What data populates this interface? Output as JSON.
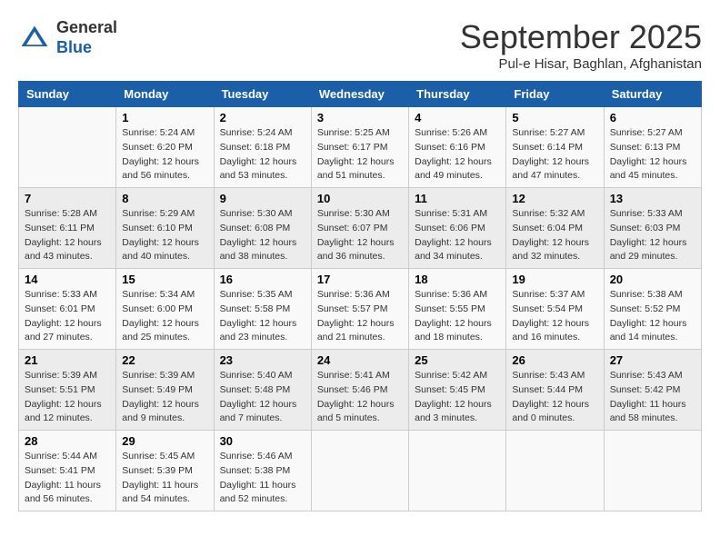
{
  "header": {
    "logo_general": "General",
    "logo_blue": "Blue",
    "month_title": "September 2025",
    "location": "Pul-e Hisar, Baghlan, Afghanistan"
  },
  "calendar": {
    "days_of_week": [
      "Sunday",
      "Monday",
      "Tuesday",
      "Wednesday",
      "Thursday",
      "Friday",
      "Saturday"
    ],
    "weeks": [
      [
        {
          "day": "",
          "info": ""
        },
        {
          "day": "1",
          "info": "Sunrise: 5:24 AM\nSunset: 6:20 PM\nDaylight: 12 hours\nand 56 minutes."
        },
        {
          "day": "2",
          "info": "Sunrise: 5:24 AM\nSunset: 6:18 PM\nDaylight: 12 hours\nand 53 minutes."
        },
        {
          "day": "3",
          "info": "Sunrise: 5:25 AM\nSunset: 6:17 PM\nDaylight: 12 hours\nand 51 minutes."
        },
        {
          "day": "4",
          "info": "Sunrise: 5:26 AM\nSunset: 6:16 PM\nDaylight: 12 hours\nand 49 minutes."
        },
        {
          "day": "5",
          "info": "Sunrise: 5:27 AM\nSunset: 6:14 PM\nDaylight: 12 hours\nand 47 minutes."
        },
        {
          "day": "6",
          "info": "Sunrise: 5:27 AM\nSunset: 6:13 PM\nDaylight: 12 hours\nand 45 minutes."
        }
      ],
      [
        {
          "day": "7",
          "info": "Sunrise: 5:28 AM\nSunset: 6:11 PM\nDaylight: 12 hours\nand 43 minutes."
        },
        {
          "day": "8",
          "info": "Sunrise: 5:29 AM\nSunset: 6:10 PM\nDaylight: 12 hours\nand 40 minutes."
        },
        {
          "day": "9",
          "info": "Sunrise: 5:30 AM\nSunset: 6:08 PM\nDaylight: 12 hours\nand 38 minutes."
        },
        {
          "day": "10",
          "info": "Sunrise: 5:30 AM\nSunset: 6:07 PM\nDaylight: 12 hours\nand 36 minutes."
        },
        {
          "day": "11",
          "info": "Sunrise: 5:31 AM\nSunset: 6:06 PM\nDaylight: 12 hours\nand 34 minutes."
        },
        {
          "day": "12",
          "info": "Sunrise: 5:32 AM\nSunset: 6:04 PM\nDaylight: 12 hours\nand 32 minutes."
        },
        {
          "day": "13",
          "info": "Sunrise: 5:33 AM\nSunset: 6:03 PM\nDaylight: 12 hours\nand 29 minutes."
        }
      ],
      [
        {
          "day": "14",
          "info": "Sunrise: 5:33 AM\nSunset: 6:01 PM\nDaylight: 12 hours\nand 27 minutes."
        },
        {
          "day": "15",
          "info": "Sunrise: 5:34 AM\nSunset: 6:00 PM\nDaylight: 12 hours\nand 25 minutes."
        },
        {
          "day": "16",
          "info": "Sunrise: 5:35 AM\nSunset: 5:58 PM\nDaylight: 12 hours\nand 23 minutes."
        },
        {
          "day": "17",
          "info": "Sunrise: 5:36 AM\nSunset: 5:57 PM\nDaylight: 12 hours\nand 21 minutes."
        },
        {
          "day": "18",
          "info": "Sunrise: 5:36 AM\nSunset: 5:55 PM\nDaylight: 12 hours\nand 18 minutes."
        },
        {
          "day": "19",
          "info": "Sunrise: 5:37 AM\nSunset: 5:54 PM\nDaylight: 12 hours\nand 16 minutes."
        },
        {
          "day": "20",
          "info": "Sunrise: 5:38 AM\nSunset: 5:52 PM\nDaylight: 12 hours\nand 14 minutes."
        }
      ],
      [
        {
          "day": "21",
          "info": "Sunrise: 5:39 AM\nSunset: 5:51 PM\nDaylight: 12 hours\nand 12 minutes."
        },
        {
          "day": "22",
          "info": "Sunrise: 5:39 AM\nSunset: 5:49 PM\nDaylight: 12 hours\nand 9 minutes."
        },
        {
          "day": "23",
          "info": "Sunrise: 5:40 AM\nSunset: 5:48 PM\nDaylight: 12 hours\nand 7 minutes."
        },
        {
          "day": "24",
          "info": "Sunrise: 5:41 AM\nSunset: 5:46 PM\nDaylight: 12 hours\nand 5 minutes."
        },
        {
          "day": "25",
          "info": "Sunrise: 5:42 AM\nSunset: 5:45 PM\nDaylight: 12 hours\nand 3 minutes."
        },
        {
          "day": "26",
          "info": "Sunrise: 5:43 AM\nSunset: 5:44 PM\nDaylight: 12 hours\nand 0 minutes."
        },
        {
          "day": "27",
          "info": "Sunrise: 5:43 AM\nSunset: 5:42 PM\nDaylight: 11 hours\nand 58 minutes."
        }
      ],
      [
        {
          "day": "28",
          "info": "Sunrise: 5:44 AM\nSunset: 5:41 PM\nDaylight: 11 hours\nand 56 minutes."
        },
        {
          "day": "29",
          "info": "Sunrise: 5:45 AM\nSunset: 5:39 PM\nDaylight: 11 hours\nand 54 minutes."
        },
        {
          "day": "30",
          "info": "Sunrise: 5:46 AM\nSunset: 5:38 PM\nDaylight: 11 hours\nand 52 minutes."
        },
        {
          "day": "",
          "info": ""
        },
        {
          "day": "",
          "info": ""
        },
        {
          "day": "",
          "info": ""
        },
        {
          "day": "",
          "info": ""
        }
      ]
    ]
  }
}
